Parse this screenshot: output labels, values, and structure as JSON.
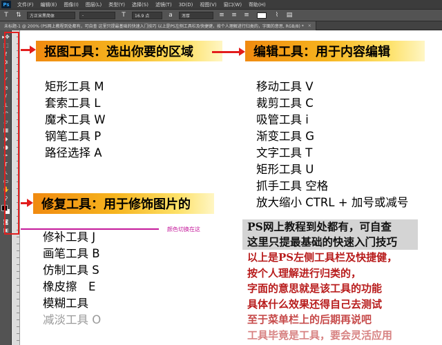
{
  "app": {
    "logo": "Ps",
    "menus": [
      "文件(F)",
      "编辑(E)",
      "图像(I)",
      "图层(L)",
      "类型(Y)",
      "选择(S)",
      "滤镜(T)",
      "3D(D)",
      "视图(V)",
      "窗口(W)",
      "帮助(H)"
    ]
  },
  "options": {
    "font_family": "方正宋黑简体",
    "font_style": "-",
    "font_size": "16.9 点",
    "antialias": "浑厚"
  },
  "document_tab": {
    "title": "未标题-1 @ 200% (PS网上教程到处都有，可自查 这里只提最基础的快速入门技巧 以上是PS左侧工具栏及快捷键，按个人理解进行归类的，字面的意思, RGB/8) *",
    "close": "×"
  },
  "tools": [
    {
      "icon": "move-tool-icon",
      "glyph": "▸✥"
    },
    {
      "icon": "marquee-tool-icon",
      "glyph": "⬚"
    },
    {
      "icon": "lasso-tool-icon",
      "glyph": "ℓ"
    },
    {
      "icon": "magic-wand-tool-icon",
      "glyph": "✲"
    },
    {
      "icon": "crop-tool-icon",
      "glyph": "⌗"
    },
    {
      "icon": "eyedropper-tool-icon",
      "glyph": "⁄"
    },
    {
      "icon": "healing-brush-tool-icon",
      "glyph": "⊘"
    },
    {
      "icon": "brush-tool-icon",
      "glyph": "∕"
    },
    {
      "icon": "clone-stamp-tool-icon",
      "glyph": "⊥"
    },
    {
      "icon": "history-brush-tool-icon",
      "glyph": "↶"
    },
    {
      "icon": "eraser-tool-icon",
      "glyph": "▱"
    },
    {
      "icon": "gradient-tool-icon",
      "glyph": "▦"
    },
    {
      "icon": "blur-tool-icon",
      "glyph": "◆"
    },
    {
      "icon": "dodge-tool-icon",
      "glyph": "●"
    },
    {
      "icon": "pen-tool-icon",
      "glyph": "✒"
    },
    {
      "icon": "type-tool-icon",
      "glyph": "T"
    },
    {
      "icon": "path-selection-tool-icon",
      "glyph": "↖"
    },
    {
      "icon": "shape-tool-icon",
      "glyph": "▭"
    },
    {
      "icon": "hand-tool-icon",
      "glyph": "✋"
    },
    {
      "icon": "zoom-tool-icon",
      "glyph": "⚲"
    }
  ],
  "content": {
    "selection_title": "抠图工具：选出你要的区域",
    "selection_tools": [
      "矩形工具 M",
      "套索工具 L",
      "魔术工具 W",
      "钢笔工具 P",
      "路径选择 A"
    ],
    "edit_title": "编辑工具：用于内容编辑",
    "edit_tools": [
      "移动工具 V",
      "裁剪工具 C",
      "吸管工具 i",
      "渐变工具 G",
      "文字工具 T",
      "矩形工具 U",
      "抓手工具 空格",
      "放大缩小 CTRL + 加号或减号"
    ],
    "repair_title": "修复工具：用于修饰图片的",
    "repair_tools": [
      "修补工具 J",
      "画笔工具 B",
      "仿制工具 S",
      "橡皮擦　E",
      "模糊工具",
      "减淡工具 O"
    ],
    "color_swap_note": "颜色切换在这",
    "note_dark": [
      "PS网上教程到处都有，可自查",
      "这里只提最基础的快速入门技巧"
    ],
    "note_red": [
      "以上是PS左侧工具栏及快捷健，",
      "按个人理解进行归类的，",
      "字面的意思就是该工具的功能",
      "具体什么效果还得自己去测试",
      "至于菜单栏上的后期再说吧",
      "工具毕竟是工具，要会灵活应用"
    ]
  },
  "colors": {
    "banner_start": "#f08a10",
    "banner_end": "#fff6c4",
    "arrow": "#e21c1c",
    "note_red": "#b81c1c",
    "annotation": "#c4189a"
  }
}
